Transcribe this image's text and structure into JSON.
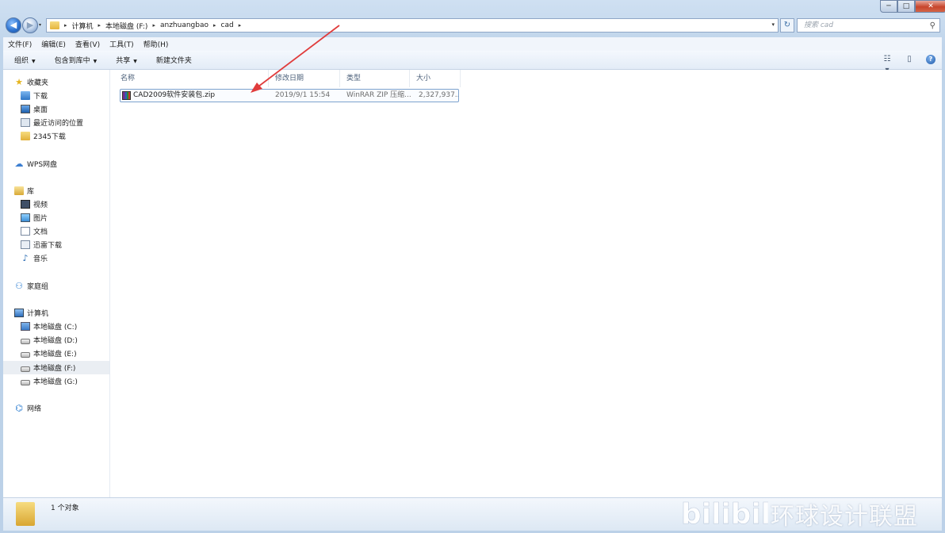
{
  "window_controls": {
    "minimize": "─",
    "maximize": "□",
    "close": "✕"
  },
  "nav": {
    "back": "◀",
    "forward": "▶",
    "history_dropdown": "▾"
  },
  "address": {
    "crumbs": [
      "计算机",
      "本地磁盘 (F:)",
      "anzhuangbao",
      "cad"
    ],
    "separator": "▸",
    "dropdown": "▾",
    "refresh": "↻"
  },
  "search": {
    "placeholder": "搜索 cad",
    "icon": "search-icon"
  },
  "menubar": [
    "文件(F)",
    "编辑(E)",
    "查看(V)",
    "工具(T)",
    "帮助(H)"
  ],
  "toolbar": {
    "items": [
      "组织",
      "包含到库中",
      "共享",
      "新建文件夹"
    ],
    "caret": "▼"
  },
  "sidebar": {
    "favorites": {
      "label": "收藏夹",
      "items": [
        "下载",
        "桌面",
        "最近访问的位置",
        "2345下载"
      ]
    },
    "wps": {
      "label": "WPS网盘"
    },
    "libraries": {
      "label": "库",
      "items": [
        "视频",
        "图片",
        "文档",
        "迅雷下载",
        "音乐"
      ]
    },
    "homegroup": {
      "label": "家庭组"
    },
    "computer": {
      "label": "计算机",
      "items": [
        "本地磁盘 (C:)",
        "本地磁盘 (D:)",
        "本地磁盘 (E:)",
        "本地磁盘 (F:)",
        "本地磁盘 (G:)"
      ]
    },
    "network": {
      "label": "网络"
    }
  },
  "columns": [
    "名称",
    "修改日期",
    "类型",
    "大小"
  ],
  "files": [
    {
      "name": "CAD2009软件安装包.zip",
      "modified": "2019/9/1 15:54",
      "type": "WinRAR ZIP 压缩...",
      "size": "2,327,937..."
    }
  ],
  "status": {
    "count_text": "1 个对象"
  },
  "watermark": {
    "text": "环球设计联盟",
    "logo": "bilibili"
  },
  "colors": {
    "selection_border": "#7da2ce",
    "annotation_arrow": "#e03c3c"
  }
}
